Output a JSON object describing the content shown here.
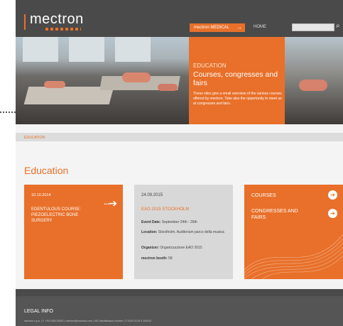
{
  "header": {
    "logo": "mectron",
    "nav_active": "mectron MEDICAL",
    "nav_home": "HOME",
    "search_placeholder": ""
  },
  "hero": {
    "eyebrow": "EDUCATION",
    "title": "Courses, congresses and fairs",
    "body": "These sites give a small overview of the various courses offered by mectron. Take also the opportunity to meet us at congresses and fairs."
  },
  "breadcrumb": "EDUCATION",
  "section_title": "Education",
  "news_tile": {
    "date": "10.10.2014",
    "title": "EDENTULOUS COURSE: PIEZOELECTRIC BONE SURGERY"
  },
  "event_tile": {
    "date": "24.09.2015",
    "title": "EAO 2015 STOCKHOLM",
    "event_date_label": "Event Date:",
    "event_date_value": "September 24th - 26th",
    "location_label": "Location:",
    "location_value": "Stockholm, Auditorium parco della musica",
    "organizer_label": "Organizer:",
    "organizer_value": "Organizzazione EAO 2015",
    "booth_label": "mectron booth:",
    "booth_value": "58"
  },
  "links_tile": {
    "courses": "COURSES",
    "congresses": "CONGRESSES AND FAIRS"
  },
  "footer": {
    "legal": "LEGAL INFO",
    "line": "mectron s.p.a. | T: +39 0185 35361 | mectron@mectron.com | VAT identification number: IT 00 ID 0175 0 100010"
  },
  "colors": {
    "accent": "#e8702a",
    "header": "#4a4a4a",
    "footer": "#555555"
  }
}
